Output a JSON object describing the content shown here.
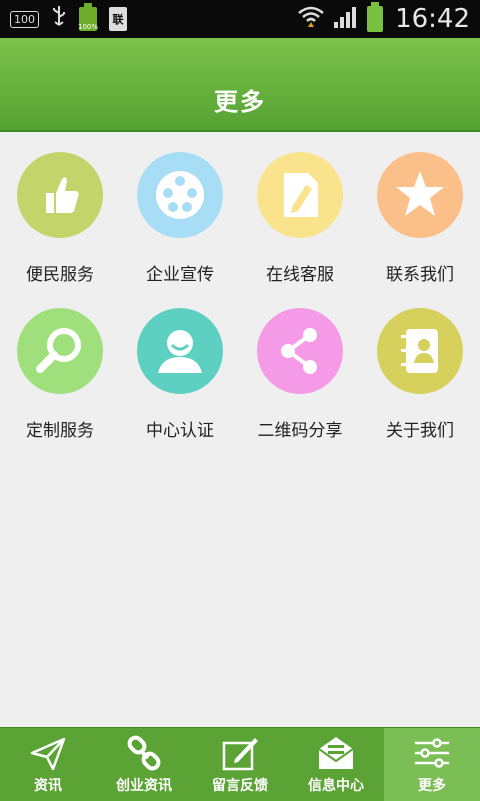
{
  "status_bar": {
    "indicator": "100",
    "battery_small": "100%",
    "sim_label": "联",
    "time": "16:42"
  },
  "header": {
    "title": "更多"
  },
  "grid": [
    {
      "label": "便民服务",
      "icon": "thumbs-up-icon",
      "color": "#c2d46a"
    },
    {
      "label": "企业宣传",
      "icon": "film-reel-icon",
      "color": "#a8def5"
    },
    {
      "label": "在线客服",
      "icon": "document-edit-icon",
      "color": "#f9e38c"
    },
    {
      "label": "联系我们",
      "icon": "star-icon",
      "color": "#fbbf8a"
    },
    {
      "label": "定制服务",
      "icon": "magnifier-icon",
      "color": "#9fe07c"
    },
    {
      "label": "中心认证",
      "icon": "user-icon",
      "color": "#5ed0c2"
    },
    {
      "label": "二维码分享",
      "icon": "share-icon",
      "color": "#f49ae6"
    },
    {
      "label": "关于我们",
      "icon": "contact-book-icon",
      "color": "#d6d05c"
    }
  ],
  "tabs": [
    {
      "label": "资讯",
      "icon": "paper-plane-icon"
    },
    {
      "label": "创业资讯",
      "icon": "chain-link-icon"
    },
    {
      "label": "留言反馈",
      "icon": "pen-note-icon"
    },
    {
      "label": "信息中心",
      "icon": "envelope-icon"
    },
    {
      "label": "更多",
      "icon": "sliders-icon",
      "active": true
    }
  ],
  "colors": {
    "header_green": "#5aa334",
    "accent_green": "#7bbe55"
  }
}
